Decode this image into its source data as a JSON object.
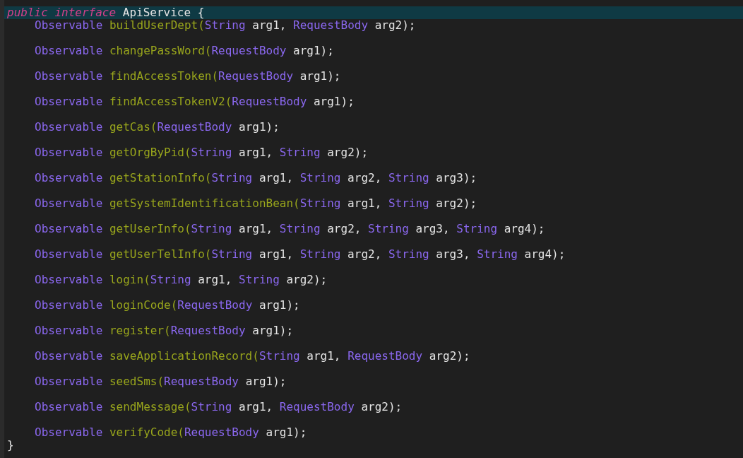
{
  "editor": {
    "lines": [
      {
        "kind": "declaration",
        "current": true,
        "tokens": [
          {
            "kind": "keyword",
            "text": "public"
          },
          {
            "kind": "keyword",
            "text": " interface"
          },
          {
            "kind": "plain",
            "text": " ApiService {"
          }
        ]
      },
      {
        "kind": "member",
        "current": false,
        "tokens": [
          {
            "kind": "type",
            "text": "Observable"
          },
          {
            "kind": "method",
            "text": " buildUserDept("
          },
          {
            "kind": "type",
            "text": "String"
          },
          {
            "kind": "plain",
            "text": " arg1, "
          },
          {
            "kind": "type",
            "text": "RequestBody"
          },
          {
            "kind": "plain",
            "text": " arg2);"
          }
        ]
      },
      {
        "kind": "member",
        "current": false,
        "tokens": [
          {
            "kind": "type",
            "text": "Observable"
          },
          {
            "kind": "method",
            "text": " changePassWord("
          },
          {
            "kind": "type",
            "text": "RequestBody"
          },
          {
            "kind": "plain",
            "text": " arg1);"
          }
        ]
      },
      {
        "kind": "member",
        "current": false,
        "tokens": [
          {
            "kind": "type",
            "text": "Observable"
          },
          {
            "kind": "method",
            "text": " findAccessToken("
          },
          {
            "kind": "type",
            "text": "RequestBody"
          },
          {
            "kind": "plain",
            "text": " arg1);"
          }
        ]
      },
      {
        "kind": "member",
        "current": false,
        "tokens": [
          {
            "kind": "type",
            "text": "Observable"
          },
          {
            "kind": "method",
            "text": " findAccessTokenV2("
          },
          {
            "kind": "type",
            "text": "RequestBody"
          },
          {
            "kind": "plain",
            "text": " arg1);"
          }
        ]
      },
      {
        "kind": "member",
        "current": false,
        "tokens": [
          {
            "kind": "type",
            "text": "Observable"
          },
          {
            "kind": "method",
            "text": " getCas("
          },
          {
            "kind": "type",
            "text": "RequestBody"
          },
          {
            "kind": "plain",
            "text": " arg1);"
          }
        ]
      },
      {
        "kind": "member",
        "current": false,
        "tokens": [
          {
            "kind": "type",
            "text": "Observable"
          },
          {
            "kind": "method",
            "text": " getOrgByPid("
          },
          {
            "kind": "type",
            "text": "String"
          },
          {
            "kind": "plain",
            "text": " arg1, "
          },
          {
            "kind": "type",
            "text": "String"
          },
          {
            "kind": "plain",
            "text": " arg2);"
          }
        ]
      },
      {
        "kind": "member",
        "current": false,
        "tokens": [
          {
            "kind": "type",
            "text": "Observable"
          },
          {
            "kind": "method",
            "text": " getStationInfo("
          },
          {
            "kind": "type",
            "text": "String"
          },
          {
            "kind": "plain",
            "text": " arg1, "
          },
          {
            "kind": "type",
            "text": "String"
          },
          {
            "kind": "plain",
            "text": " arg2, "
          },
          {
            "kind": "type",
            "text": "String"
          },
          {
            "kind": "plain",
            "text": " arg3);"
          }
        ]
      },
      {
        "kind": "member",
        "current": false,
        "tokens": [
          {
            "kind": "type",
            "text": "Observable"
          },
          {
            "kind": "method",
            "text": " getSystemIdentificationBean("
          },
          {
            "kind": "type",
            "text": "String"
          },
          {
            "kind": "plain",
            "text": " arg1, "
          },
          {
            "kind": "type",
            "text": "String"
          },
          {
            "kind": "plain",
            "text": " arg2);"
          }
        ]
      },
      {
        "kind": "member",
        "current": false,
        "tokens": [
          {
            "kind": "type",
            "text": "Observable"
          },
          {
            "kind": "method",
            "text": " getUserInfo("
          },
          {
            "kind": "type",
            "text": "String"
          },
          {
            "kind": "plain",
            "text": " arg1, "
          },
          {
            "kind": "type",
            "text": "String"
          },
          {
            "kind": "plain",
            "text": " arg2, "
          },
          {
            "kind": "type",
            "text": "String"
          },
          {
            "kind": "plain",
            "text": " arg3, "
          },
          {
            "kind": "type",
            "text": "String"
          },
          {
            "kind": "plain",
            "text": " arg4);"
          }
        ]
      },
      {
        "kind": "member",
        "current": false,
        "tokens": [
          {
            "kind": "type",
            "text": "Observable"
          },
          {
            "kind": "method",
            "text": " getUserTelInfo("
          },
          {
            "kind": "type",
            "text": "String"
          },
          {
            "kind": "plain",
            "text": " arg1, "
          },
          {
            "kind": "type",
            "text": "String"
          },
          {
            "kind": "plain",
            "text": " arg2, "
          },
          {
            "kind": "type",
            "text": "String"
          },
          {
            "kind": "plain",
            "text": " arg3, "
          },
          {
            "kind": "type",
            "text": "String"
          },
          {
            "kind": "plain",
            "text": " arg4);"
          }
        ]
      },
      {
        "kind": "member",
        "current": false,
        "tokens": [
          {
            "kind": "type",
            "text": "Observable"
          },
          {
            "kind": "method",
            "text": " login("
          },
          {
            "kind": "type",
            "text": "String"
          },
          {
            "kind": "plain",
            "text": " arg1, "
          },
          {
            "kind": "type",
            "text": "String"
          },
          {
            "kind": "plain",
            "text": " arg2);"
          }
        ]
      },
      {
        "kind": "member",
        "current": false,
        "tokens": [
          {
            "kind": "type",
            "text": "Observable"
          },
          {
            "kind": "method",
            "text": " loginCode("
          },
          {
            "kind": "type",
            "text": "RequestBody"
          },
          {
            "kind": "plain",
            "text": " arg1);"
          }
        ]
      },
      {
        "kind": "member",
        "current": false,
        "tokens": [
          {
            "kind": "type",
            "text": "Observable"
          },
          {
            "kind": "method",
            "text": " register("
          },
          {
            "kind": "type",
            "text": "RequestBody"
          },
          {
            "kind": "plain",
            "text": " arg1);"
          }
        ]
      },
      {
        "kind": "member",
        "current": false,
        "tokens": [
          {
            "kind": "type",
            "text": "Observable"
          },
          {
            "kind": "method",
            "text": " saveApplicationRecord("
          },
          {
            "kind": "type",
            "text": "String"
          },
          {
            "kind": "plain",
            "text": " arg1, "
          },
          {
            "kind": "type",
            "text": "RequestBody"
          },
          {
            "kind": "plain",
            "text": " arg2);"
          }
        ]
      },
      {
        "kind": "member",
        "current": false,
        "tokens": [
          {
            "kind": "type",
            "text": "Observable"
          },
          {
            "kind": "method",
            "text": " seedSms("
          },
          {
            "kind": "type",
            "text": "RequestBody"
          },
          {
            "kind": "plain",
            "text": " arg1);"
          }
        ]
      },
      {
        "kind": "member",
        "current": false,
        "tokens": [
          {
            "kind": "type",
            "text": "Observable"
          },
          {
            "kind": "method",
            "text": " sendMessage("
          },
          {
            "kind": "type",
            "text": "String"
          },
          {
            "kind": "plain",
            "text": " arg1, "
          },
          {
            "kind": "type",
            "text": "RequestBody"
          },
          {
            "kind": "plain",
            "text": " arg2);"
          }
        ]
      },
      {
        "kind": "member",
        "current": false,
        "tokens": [
          {
            "kind": "type",
            "text": "Observable"
          },
          {
            "kind": "method",
            "text": " verifyCode("
          },
          {
            "kind": "type",
            "text": "RequestBody"
          },
          {
            "kind": "plain",
            "text": " arg1);"
          }
        ]
      },
      {
        "kind": "close",
        "current": false,
        "tokens": [
          {
            "kind": "plain",
            "text": "}"
          }
        ]
      }
    ]
  }
}
